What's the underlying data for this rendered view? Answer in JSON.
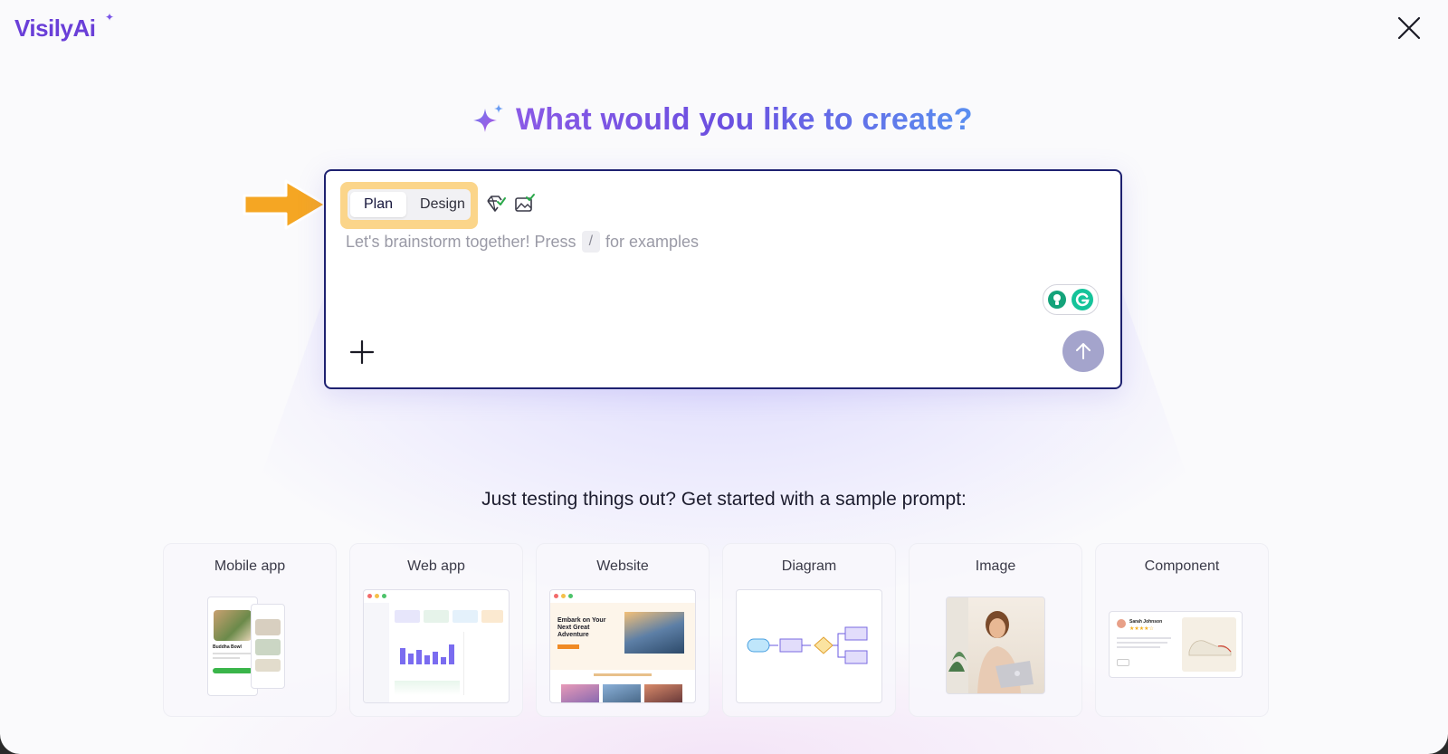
{
  "app": {
    "logo_text": "Visily",
    "logo_ai": "Ai"
  },
  "headline": "What would you like to create?",
  "prompt": {
    "modes": [
      "Plan",
      "Design"
    ],
    "active_mode": "Plan",
    "placeholder_before": "Let's brainstorm together! Press",
    "slash_key": "/",
    "placeholder_after": "for examples"
  },
  "icons": {
    "close": "close-icon",
    "sparkle": "sparkle-icon",
    "diamond_check": "diamond-check-icon",
    "image_check": "image-check-icon",
    "add": "plus-icon",
    "send": "arrow-up-icon",
    "grammarly": "grammarly-icon",
    "callout_arrow": "arrow-right-icon"
  },
  "colors": {
    "accent": "#6a3fd8",
    "border": "#1e2170",
    "highlight": "#fbd58a",
    "arrow": "#f5a623",
    "send_button": "#a4a4cc"
  },
  "samples": {
    "heading": "Just testing things out? Get started with a sample prompt:",
    "cards": [
      {
        "label": "Mobile app",
        "preview_text": "Buddha Bowl"
      },
      {
        "label": "Web app"
      },
      {
        "label": "Website",
        "preview_text": "Embark on Your Next Great Adventure"
      },
      {
        "label": "Diagram"
      },
      {
        "label": "Image"
      },
      {
        "label": "Component",
        "preview_text": "Sarah Johnson"
      }
    ]
  }
}
